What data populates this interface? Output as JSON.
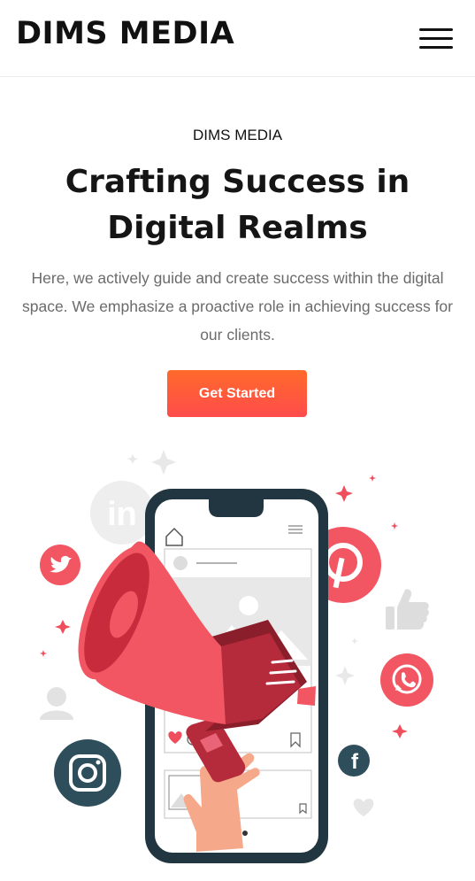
{
  "header": {
    "logo": "DIMS MEDIA",
    "menu_icon": "hamburger-menu-icon"
  },
  "hero": {
    "eyebrow": "DIMS MEDIA",
    "title": "Crafting Success in Digital Realms",
    "description": "Here, we actively guide and create success within the digital space. We emphasize a proactive role in achieving success for our clients.",
    "cta_label": "Get Started"
  },
  "illustration": {
    "icons": [
      "linkedin-icon",
      "twitter-icon",
      "pinterest-icon",
      "thumbs-up-icon",
      "whatsapp-icon",
      "user-icon",
      "instagram-icon",
      "facebook-icon",
      "heart-icon",
      "megaphone-icon",
      "smartphone-icon"
    ],
    "phone_icon_labels": {
      "linkedin": "in",
      "facebook": "f"
    }
  },
  "colors": {
    "accent_start": "#ff6a2a",
    "accent_end": "#ff4c4c",
    "social_red": "#f25662",
    "phone_frame": "#233642",
    "text_dark": "#111111",
    "text_muted": "#6b6b6b"
  }
}
